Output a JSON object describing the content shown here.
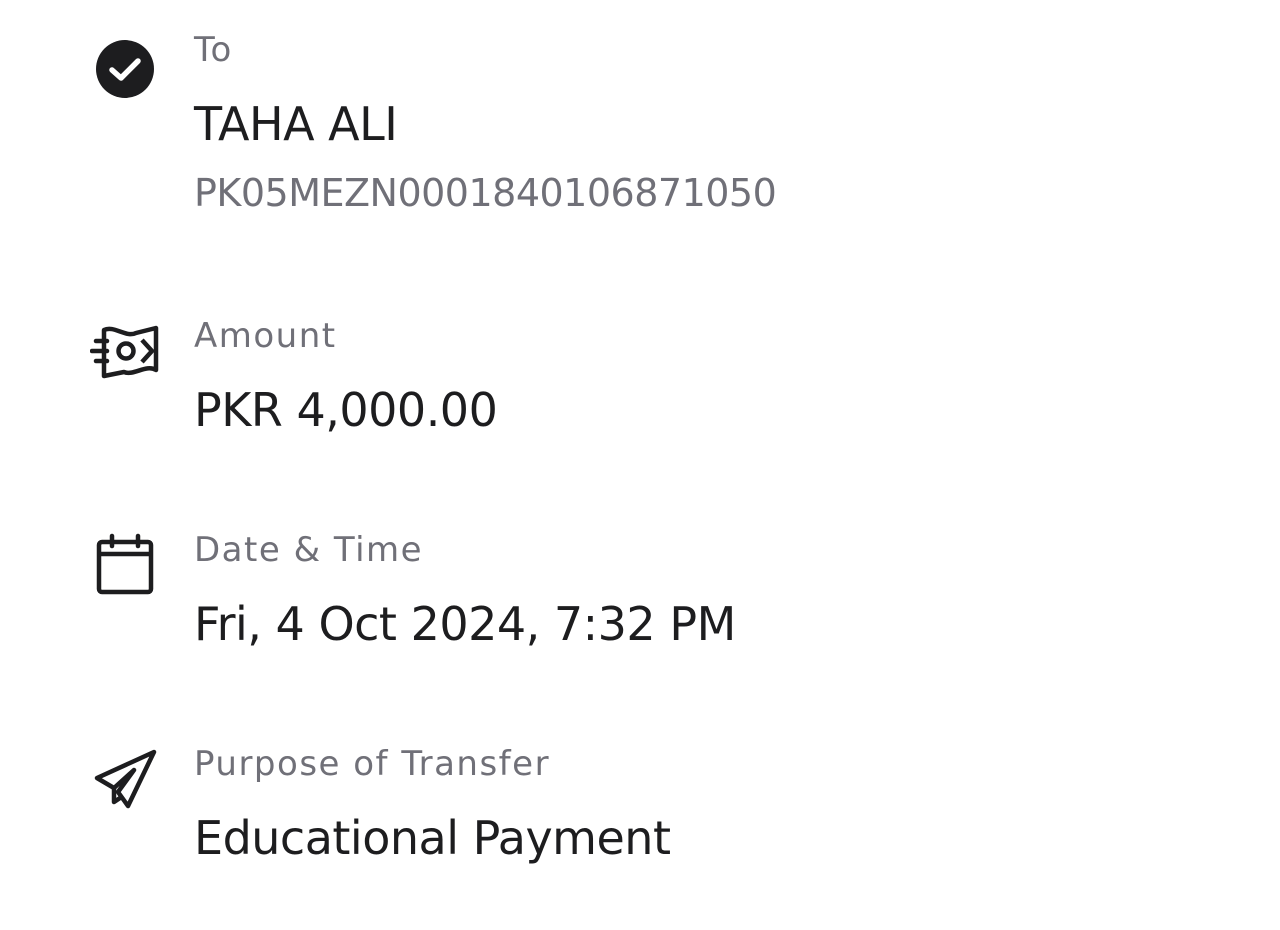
{
  "to": {
    "icon": "check-circle-icon",
    "label": "To",
    "name": "TAHA ALI",
    "account": "PK05MEZN0001840106871050"
  },
  "amount": {
    "icon": "cash-icon",
    "label": "Amount",
    "currency": "PKR",
    "value": "4,000.00"
  },
  "date_time": {
    "icon": "calendar-icon",
    "label": "Date & Time",
    "value": "Fri, 4 Oct 2024, 7:32 PM"
  },
  "purpose": {
    "icon": "send-icon",
    "label": "Purpose of Transfer",
    "value": "Educational Payment"
  },
  "colors": {
    "text_primary": "#1d1d1f",
    "text_secondary": "#707078",
    "background": "#ffffff"
  }
}
